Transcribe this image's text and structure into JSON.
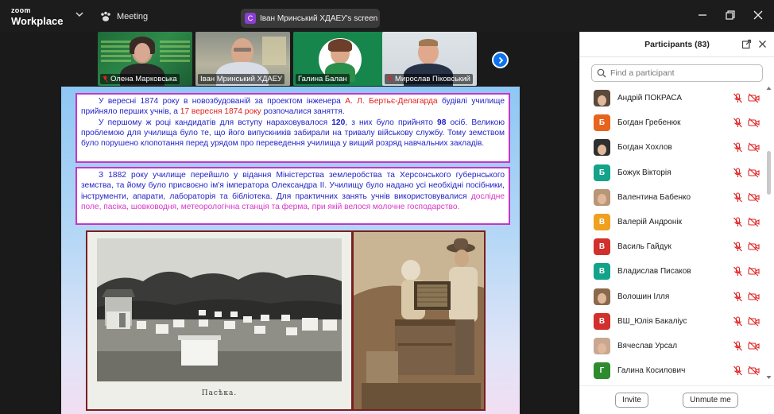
{
  "app": {
    "brand_line1": "zoom",
    "brand_line2": "Workplace",
    "meeting_label": "Meeting"
  },
  "share": {
    "avatar_letter": "С",
    "label": "Іван Мринський ХДАЕУ's screen"
  },
  "videos": [
    {
      "name": "Олена Марковська",
      "muted": true
    },
    {
      "name": "Іван Мринський ХДАЕУ",
      "muted": false,
      "active": true
    },
    {
      "name": "Галина Балан",
      "muted": false
    },
    {
      "name": "Мирослав Піковський",
      "muted": true
    }
  ],
  "slide": {
    "box1": {
      "p1_a": "У вересні 1874 року в новозбудованій за проектом інженера ",
      "p1_b": "А. Л. Бертьє-Делагарда",
      "p1_c": " будівлі училище прийняло перших учнів, а ",
      "p1_d": "17 вересня 1874 року",
      "p1_e": " розпочалися заняття.",
      "p2_a": "У першому ж році кандидатів для вступу нараховувалося ",
      "p2_b": "120",
      "p2_c": ", з них було прийнято ",
      "p2_d": "98",
      "p2_e": " осіб. Великою проблемою для училища було те, що його випускників забирали на тривалу військову службу. Тому земством було порушено клопотання перед урядом про переведення училища у вищий розряд навчальних закладів."
    },
    "box2": {
      "p1_a": "З 1882 року училище перейшло у відання Міністерства землеробства та Херсонського губернського земства, та йому було присвоєно ім'я імператора Олександра II. Училищу було надано усі необхідні посібники, інструменти, апарати, лабораторія та бібліотека. Для практичних занять учнів використовувалися ",
      "p1_b": "дослідне поле, пасіка, шовководня, метеорологічна станція та ферма, при якій велося молочне господарство."
    },
    "photo1_caption": "Пасѣка."
  },
  "participants": {
    "title": "Participants (83)",
    "search_placeholder": "Find a participant",
    "items": [
      {
        "name": "Андрій ПОКРАСА",
        "avatar_type": "photo",
        "initial": "",
        "color": "#5a4a3c"
      },
      {
        "name": "Богдан Гребенюк",
        "avatar_type": "letter",
        "initial": "Б",
        "color": "#e8641c"
      },
      {
        "name": "Богдан Хохлов",
        "avatar_type": "photo",
        "initial": "",
        "color": "#2f2f2f"
      },
      {
        "name": "Божук Вікторія",
        "avatar_type": "letter",
        "initial": "Б",
        "color": "#13a38a"
      },
      {
        "name": "Валентина Бабенко",
        "avatar_type": "photo",
        "initial": "",
        "color": "#b89676"
      },
      {
        "name": "Валерій Андронік",
        "avatar_type": "letter",
        "initial": "В",
        "color": "#f0a020"
      },
      {
        "name": "Василь Гайдук",
        "avatar_type": "letter",
        "initial": "В",
        "color": "#d1302c"
      },
      {
        "name": "Владислав Писаков",
        "avatar_type": "letter",
        "initial": "В",
        "color": "#13a38a"
      },
      {
        "name": "Волошин Ілля",
        "avatar_type": "photo",
        "initial": "",
        "color": "#8a6a4a"
      },
      {
        "name": "ВШ_Юлія Бакаліус",
        "avatar_type": "letter",
        "initial": "В",
        "color": "#d1302c"
      },
      {
        "name": "Вячеслав Урсал",
        "avatar_type": "photo",
        "initial": "",
        "color": "#c8a890"
      },
      {
        "name": "Галина Косилович",
        "avatar_type": "letter",
        "initial": "Г",
        "color": "#2e8b2e"
      }
    ],
    "invite_label": "Invite",
    "unmute_label": "Unmute me"
  },
  "colors": {
    "accent": "#0e72ed",
    "active_speaker": "#35c659",
    "muted_red": "#e02424",
    "slide_border": "#c834c8"
  }
}
